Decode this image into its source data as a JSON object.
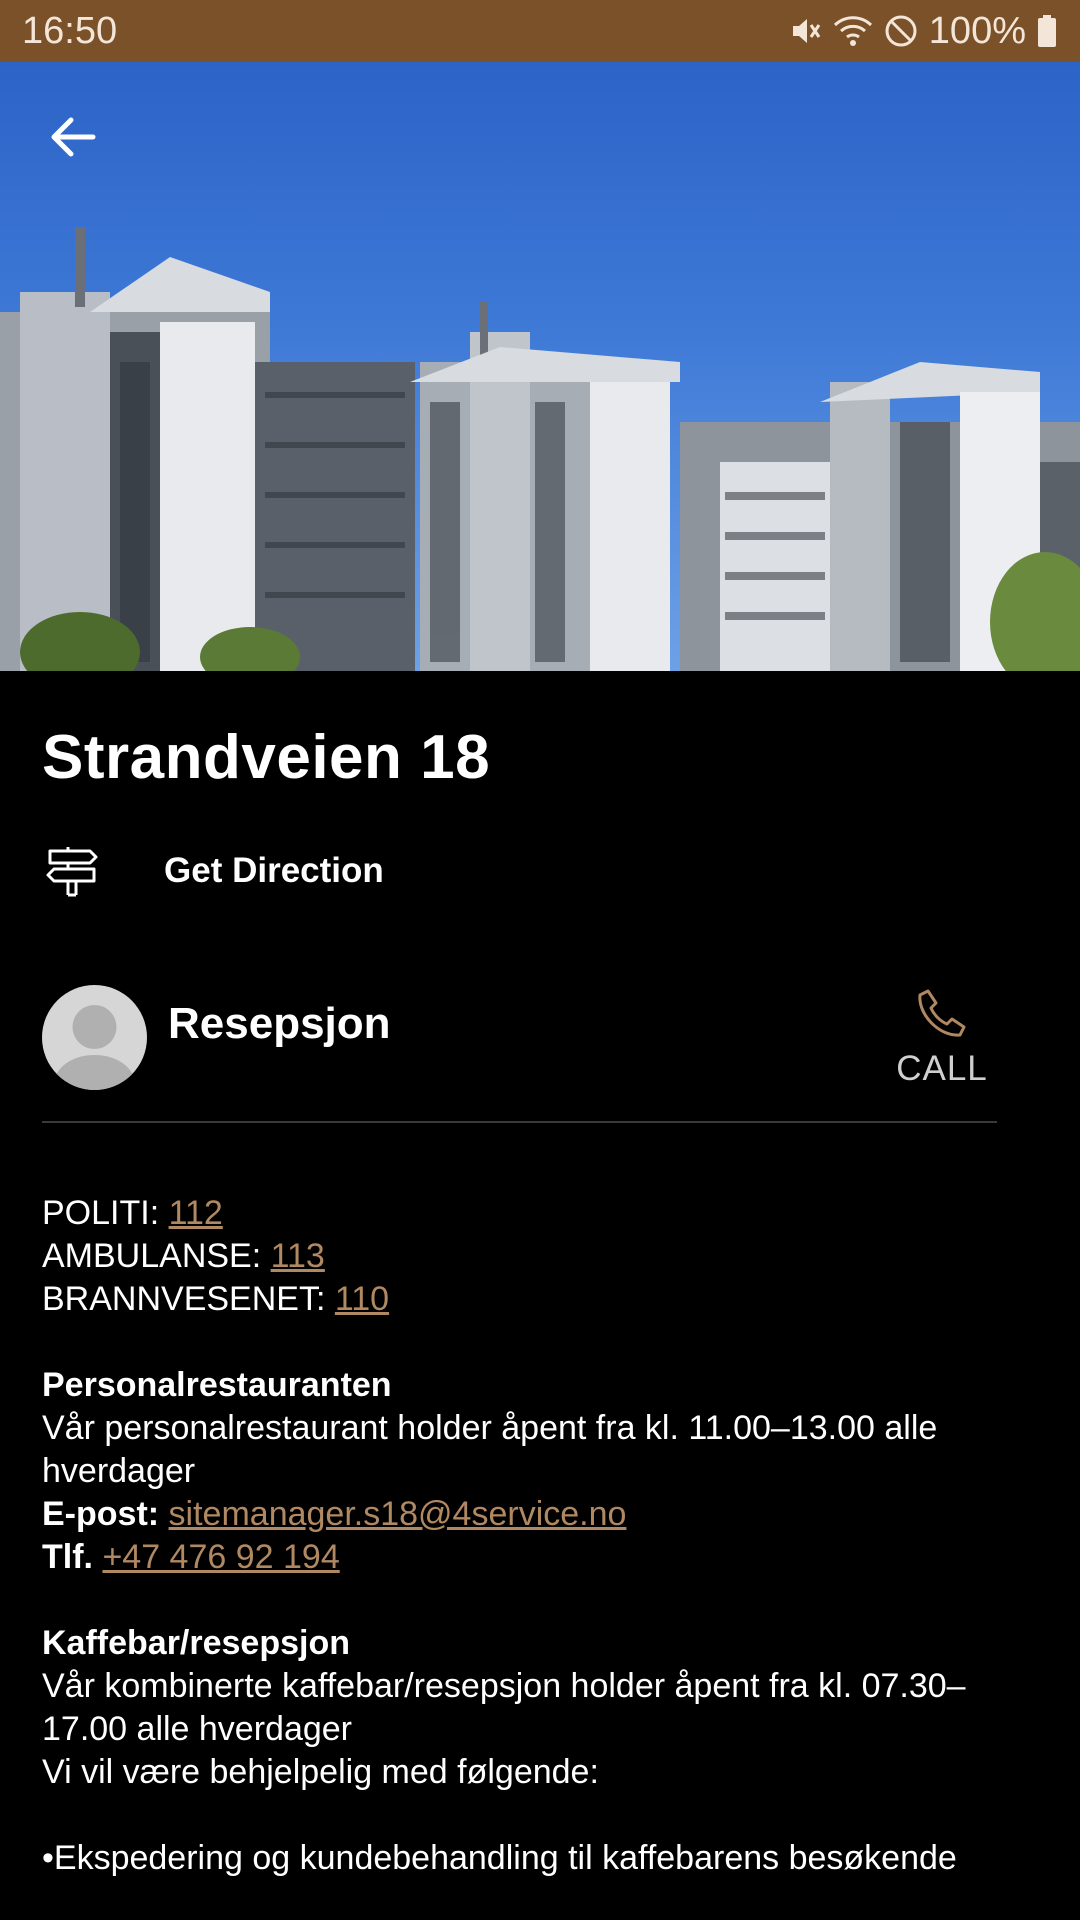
{
  "status_bar": {
    "time": "16:50",
    "battery": "100%",
    "icons": [
      "mute-icon",
      "wifi-icon",
      "do-not-disturb-icon",
      "battery-icon"
    ],
    "color": "#7a5128"
  },
  "page": {
    "title": "Strandveien 18",
    "direction_label": "Get Direction",
    "back_icon": "arrow-left-icon"
  },
  "contact": {
    "name": "Resepsjon",
    "call_label": "CALL",
    "accent": "#b08862"
  },
  "emergency": [
    {
      "label": "POLITI: ",
      "number": "112"
    },
    {
      "label": "AMBULANSE: ",
      "number": "113"
    },
    {
      "label": "BRANNVESENET: ",
      "number": "110"
    }
  ],
  "restaurant": {
    "heading": "Personalrestauranten",
    "text": "Vår personalrestaurant holder åpent fra kl. 11.00–13.00 alle hverdager",
    "email_label": "E-post: ",
    "email": "sitemanager.s18@4service.no",
    "phone_label": "Tlf. ",
    "phone": "+47 476 92 194"
  },
  "cafe": {
    "heading": "Kaffebar/resepsjon",
    "text": "Vår kombinerte kaffebar/resepsjon holder åpent fra kl. 07.30–17.00 alle hverdager",
    "help_text": "Vi vil være behjelpelig med følgende:",
    "bullet": "•Ekspedering og kundebehandling til kaffebarens besøkende"
  }
}
